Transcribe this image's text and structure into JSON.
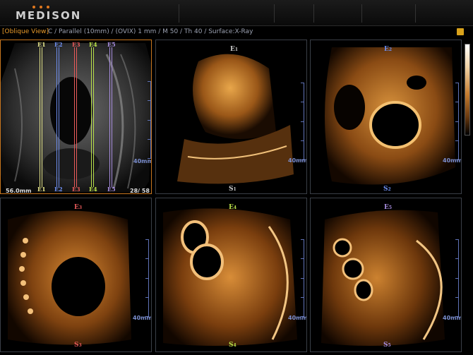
{
  "brand": {
    "logo_text": "MEDISON",
    "dot_color": "#e0781e"
  },
  "info": {
    "view": "[Oblique View]",
    "params": "C / Parallel (10mm) / (OVIX) 1 mm / M 50 / Th 40 / Surface:X-Ray"
  },
  "reference": {
    "depth": "56.0mm",
    "frame": "28/ 58",
    "slices": [
      {
        "e": "E",
        "s": "S",
        "n": "1",
        "color": "#e4e48a"
      },
      {
        "e": "E",
        "s": "S",
        "n": "2",
        "color": "#6f8ff0"
      },
      {
        "e": "E",
        "s": "S",
        "n": "3",
        "color": "#e85a5a"
      },
      {
        "e": "E",
        "s": "S",
        "n": "4",
        "color": "#b9e04a"
      },
      {
        "e": "E",
        "s": "S",
        "n": "5",
        "color": "#a98ee0"
      }
    ],
    "scale": "40mm"
  },
  "panels": [
    {
      "e": "E",
      "s": "S",
      "n": "1",
      "color": "#ffffff",
      "scale": "40mm"
    },
    {
      "e": "E",
      "s": "S",
      "n": "2",
      "color": "#6f8ff0",
      "scale": "40mm"
    },
    {
      "e": "E",
      "s": "S",
      "n": "3",
      "color": "#e85a5a",
      "scale": "40mm"
    },
    {
      "e": "E",
      "s": "S",
      "n": "4",
      "color": "#b9e04a",
      "scale": "40mm"
    },
    {
      "e": "E",
      "s": "S",
      "n": "5",
      "color": "#a98ee0",
      "scale": "40mm"
    }
  ]
}
